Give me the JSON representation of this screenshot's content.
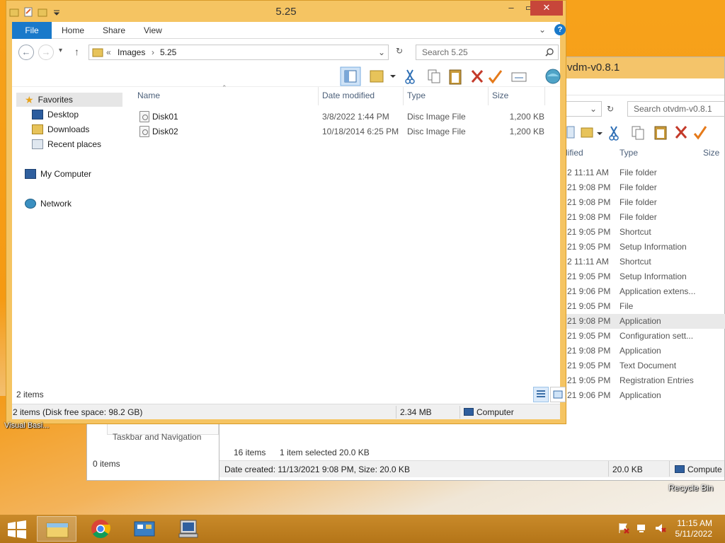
{
  "bg_window": {
    "title": "vdm-v0.8.1",
    "search_placeholder": "Search otvdm-v0.8.1",
    "col_modified": "dified",
    "col_type": "Type",
    "col_size": "Size",
    "rows": [
      {
        "date": "2 11:11 AM",
        "type": "File folder"
      },
      {
        "date": "21 9:08 PM",
        "type": "File folder"
      },
      {
        "date": "21 9:08 PM",
        "type": "File folder"
      },
      {
        "date": "21 9:08 PM",
        "type": "File folder"
      },
      {
        "date": "21 9:05 PM",
        "type": "Shortcut"
      },
      {
        "date": "21 9:05 PM",
        "type": "Setup Information"
      },
      {
        "date": "2 11:11 AM",
        "type": "Shortcut"
      },
      {
        "date": "21 9:05 PM",
        "type": "Setup Information"
      },
      {
        "date": "21 9:06 PM",
        "type": "Application extens..."
      },
      {
        "date": "21 9:05 PM",
        "type": "File"
      },
      {
        "date": "21 9:08 PM",
        "type": "Application"
      },
      {
        "date": "21 9:05 PM",
        "type": "Configuration sett..."
      },
      {
        "date": "21 9:08 PM",
        "type": "Application"
      },
      {
        "date": "21 9:05 PM",
        "type": "Text Document"
      },
      {
        "date": "21 9:05 PM",
        "type": "Registration Entries"
      },
      {
        "date": "21 9:06 PM",
        "type": "Application"
      }
    ],
    "items_count": "16 items",
    "selected": "1 item selected  20.0 KB",
    "details": "Date created: 11/13/2021 9:08 PM, Size: 20.0 KB",
    "details_size": "20.0 KB",
    "details_location": "Compute"
  },
  "bg_left": {
    "nav_text": "Taskbar and Navigation",
    "items_count": "0 items"
  },
  "window": {
    "title": "5.25",
    "tabs": {
      "file": "File",
      "home": "Home",
      "share": "Share",
      "view": "View"
    },
    "address": {
      "sep": "«",
      "crumb1": "Images",
      "crumb2": "5.25"
    },
    "search_placeholder": "Search 5.25",
    "nav": {
      "favorites": "Favorites",
      "desktop": "Desktop",
      "downloads": "Downloads",
      "recent": "Recent places",
      "computer": "My Computer",
      "network": "Network"
    },
    "columns": {
      "name": "Name",
      "date": "Date modified",
      "type": "Type",
      "size": "Size"
    },
    "files": [
      {
        "name": "Disk01",
        "date": "3/8/2022 1:44 PM",
        "type": "Disc Image File",
        "size": "1,200 KB"
      },
      {
        "name": "Disk02",
        "date": "10/18/2014 6:25 PM",
        "type": "Disc Image File",
        "size": "1,200 KB"
      }
    ],
    "items_count": "2 items",
    "status": {
      "summary": "2 items (Disk free space: 98.2 GB)",
      "size": "2.34 MB",
      "location": "Computer"
    }
  },
  "desktop": {
    "vb_label": "Visual Basi...",
    "recycle_bin": "Recycle Bin"
  },
  "taskbar": {
    "time": "11:15 AM",
    "date": "5/11/2022"
  },
  "colors": {
    "accent": "#1979ca",
    "window_frame": "#f5c462",
    "close": "#c7463a",
    "taskbar": "#b47518"
  }
}
